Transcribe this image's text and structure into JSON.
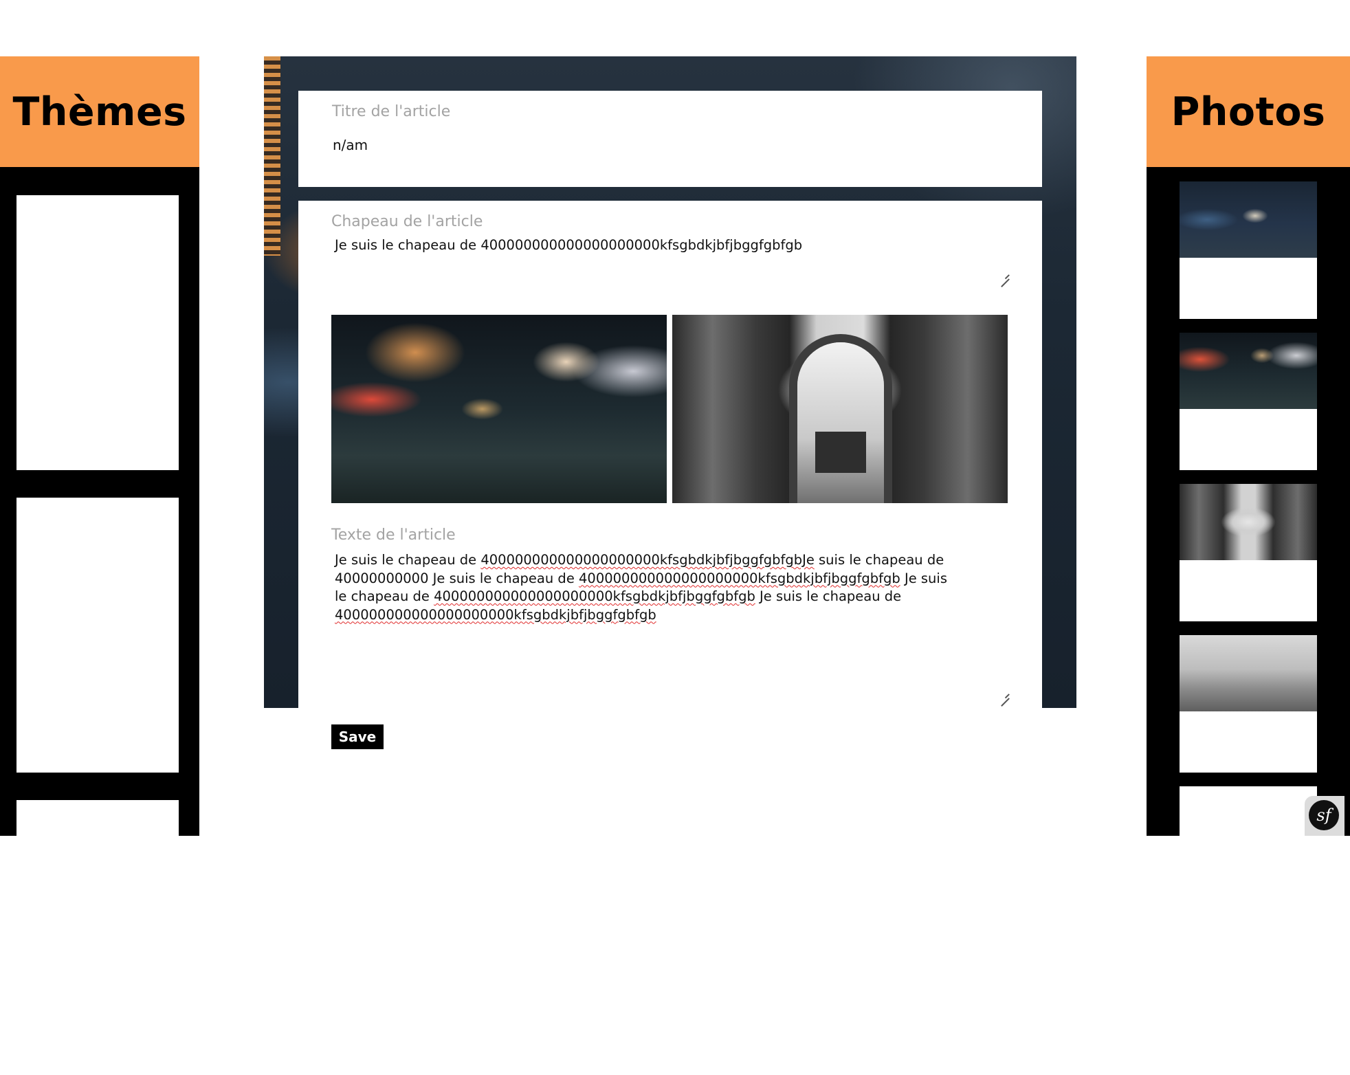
{
  "left_sidebar": {
    "title": "Thèmes"
  },
  "right_sidebar": {
    "title": "Photos"
  },
  "article_form": {
    "title_label": "Titre de l'article",
    "title_value": "n/am",
    "summary_label": "Chapeau de l'article",
    "summary_value": "Je suis le chapeau de 400000000000000000000kfsgbdkjbfjbggfgbfgb",
    "text_label": "Texte de l'article",
    "text_line_1a": "Je suis le chapeau de ",
    "text_line_1b": "400000000000000000000kfsgbdkjbfjbggfgbfgbJe",
    "text_line_1c": " suis le chapeau de",
    "text_line_2a": "40000000000 Je suis le chapeau de ",
    "text_line_2b": "400000000000000000000kfsgbdkjbfjbggfgbfgb",
    "text_line_2c": " Je suis",
    "text_line_3a": "le chapeau de ",
    "text_line_3b": "400000000000000000000kfsgbdkjbfjbggfgbfgb",
    "text_line_3c": " Je suis le chapeau de",
    "text_line_4": "400000000000000000000kfsgbdkjbfjbggfgbfgb",
    "save_label": "Save"
  },
  "symfony_badge": {
    "label": "sf"
  },
  "colors": {
    "accent": "#f99a4b",
    "sidebar_bg": "#000000",
    "spellcheck": "#e02a2a"
  }
}
